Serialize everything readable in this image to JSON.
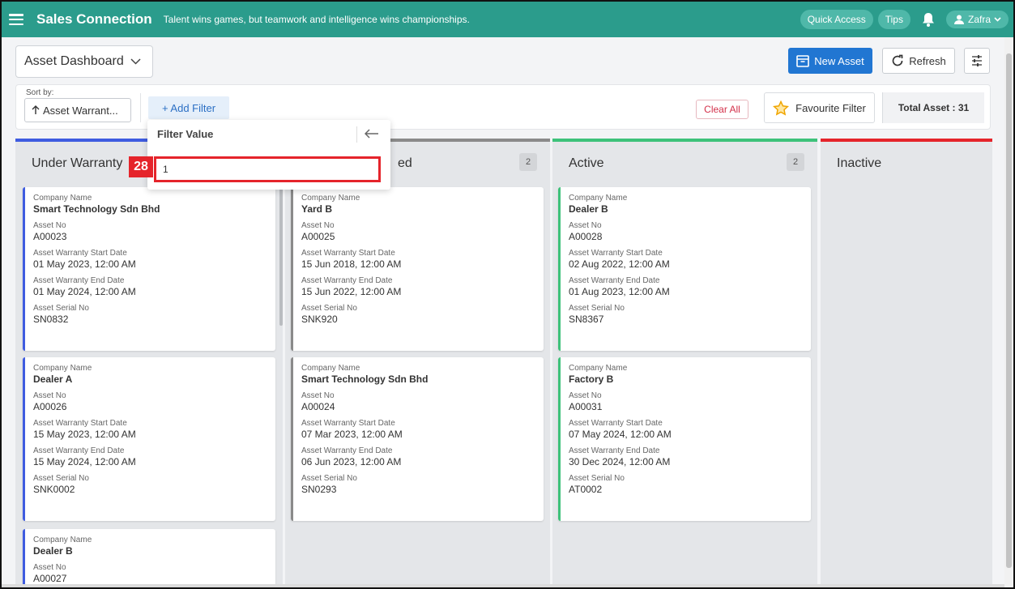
{
  "topbar": {
    "brand": "Sales Connection",
    "tagline": "Talent wins games, but teamwork and intelligence wins championships.",
    "quick_access": "Quick Access",
    "tips": "Tips",
    "user": "Zafra"
  },
  "header": {
    "dashboard_select": "Asset Dashboard",
    "new_asset": "New Asset",
    "refresh": "Refresh"
  },
  "filters": {
    "sort_label": "Sort by:",
    "sort_value": "Asset Warrant...",
    "add_filter": "+ Add Filter",
    "clear_all": "Clear All",
    "favourite_filter": "Favourite Filter",
    "total": "Total Asset : 31"
  },
  "popup": {
    "title": "Filter Value",
    "input_value": "1",
    "badge": "28"
  },
  "labels": {
    "company": "Company Name",
    "asset_no": "Asset No",
    "start": "Asset Warranty Start Date",
    "end": "Asset Warranty End Date",
    "serial": "Asset Serial No"
  },
  "columns": [
    {
      "title": "Under Warranty",
      "count": "",
      "color": "#3f5ce0",
      "cards": [
        {
          "company": "Smart Technology Sdn Bhd",
          "asset_no": "A00023",
          "start": "01 May 2023, 12:00 AM",
          "end": "01 May 2024, 12:00 AM",
          "serial": "SN0832"
        },
        {
          "company": "Dealer A",
          "asset_no": "A00026",
          "start": "15 May 2023, 12:00 AM",
          "end": "15 May 2024, 12:00 AM",
          "serial": "SNK0002"
        },
        {
          "company": "Dealer B",
          "asset_no": "A00027"
        }
      ]
    },
    {
      "title": "ed",
      "count": "2",
      "color": "#8a8a8a",
      "cards": [
        {
          "company": "Yard B",
          "asset_no": "A00025",
          "start": "15 Jun 2018, 12:00 AM",
          "end": "15 Jun 2022, 12:00 AM",
          "serial": "SNK920"
        },
        {
          "company": "Smart Technology Sdn Bhd",
          "asset_no": "A00024",
          "start": "07 Mar 2023, 12:00 AM",
          "end": "06 Jun 2023, 12:00 AM",
          "serial": "SN0293"
        }
      ]
    },
    {
      "title": "Active",
      "count": "2",
      "color": "#3ec27a",
      "cards": [
        {
          "company": "Dealer B",
          "asset_no": "A00028",
          "start": "02 Aug 2022, 12:00 AM",
          "end": "01 Aug 2023, 12:00 AM",
          "serial": "SN8367"
        },
        {
          "company": "Factory B",
          "asset_no": "A00031",
          "start": "07 May 2024, 12:00 AM",
          "end": "30 Dec 2024, 12:00 AM",
          "serial": "AT0002"
        }
      ]
    },
    {
      "title": "Inactive",
      "count": "",
      "color": "#e5242b",
      "cards": []
    }
  ]
}
